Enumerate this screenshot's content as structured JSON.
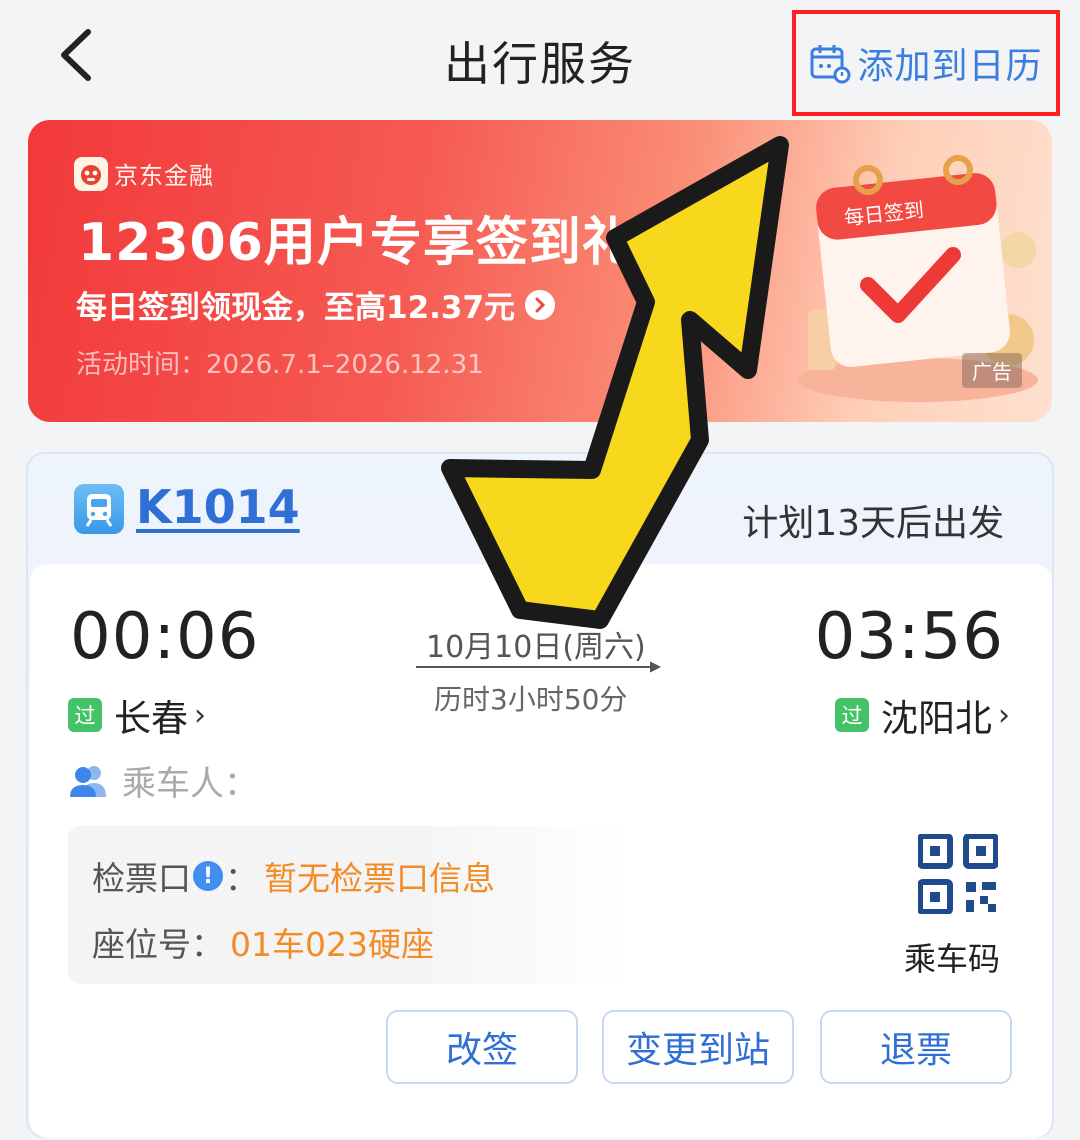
{
  "header": {
    "back_icon": "chevron-left-icon",
    "title": "出行服务",
    "add_calendar": {
      "icon": "calendar-icon",
      "label": "添加到日历",
      "highlight_color": "#ff2121"
    }
  },
  "banner": {
    "brand": "京东金融",
    "title": "12306用户专享签到礼",
    "subtitle": "每日签到领现金，至高12.37元",
    "period": "活动时间：2026.7.1–2026.12.31",
    "calendar_label": "每日签到",
    "ad_tag": "广告"
  },
  "ticket": {
    "train_no": "K1014",
    "plan": "计划13天后出发",
    "departure": {
      "time": "00:06",
      "badge": "过",
      "station": "长春"
    },
    "arrival": {
      "time": "03:56",
      "badge": "过",
      "station": "沈阳北"
    },
    "date": "10月10日(周六)",
    "duration": "历时3小时50分",
    "passenger_label": "乘车人：",
    "gate": {
      "key": "检票口",
      "warn_icon": "!",
      "sep": "：",
      "value": "暂无检票口信息"
    },
    "seat": {
      "key": "座位号：",
      "value": "01车023硬座"
    },
    "qr_label": "乘车码",
    "actions": [
      "改签",
      "变更到站",
      "退票"
    ]
  },
  "colors": {
    "accent_blue": "#2f6fd6",
    "warning_orange": "#f28c28",
    "pass_green": "#45c268",
    "banner_red": "#f2383a",
    "arrow_yellow": "#f8d81c"
  }
}
